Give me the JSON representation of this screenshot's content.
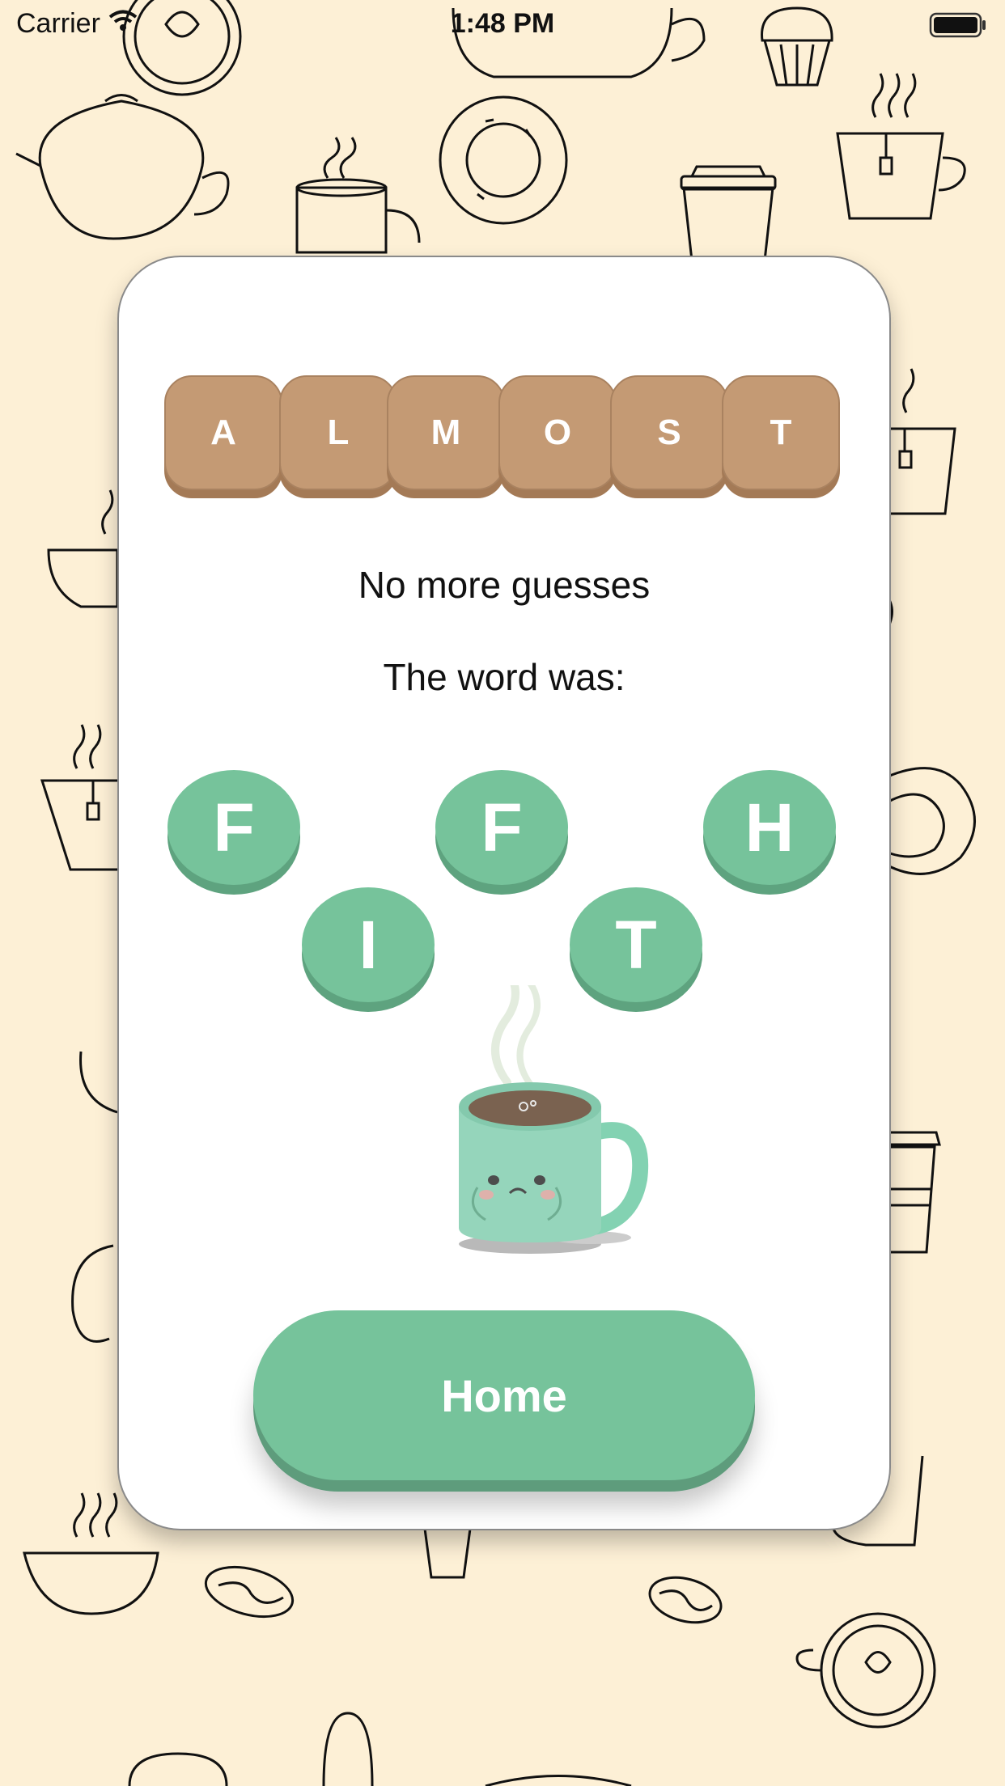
{
  "status_bar": {
    "carrier": "Carrier",
    "time": "1:48 PM"
  },
  "guess": {
    "letters": [
      "A",
      "L",
      "M",
      "O",
      "S",
      "T"
    ],
    "tile_color": "#c49a74"
  },
  "result": {
    "line1": "No more guesses",
    "line2": "The word was:"
  },
  "answer": {
    "letters": [
      "F",
      "I",
      "F",
      "T",
      "H"
    ],
    "bubble_color": "#76c39b"
  },
  "home_button": {
    "label": "Home",
    "color": "#76c39b"
  },
  "colors": {
    "background": "#fdf0d6",
    "card": "#ffffff",
    "accent_green": "#76c39b",
    "tile_brown": "#c49a74"
  }
}
